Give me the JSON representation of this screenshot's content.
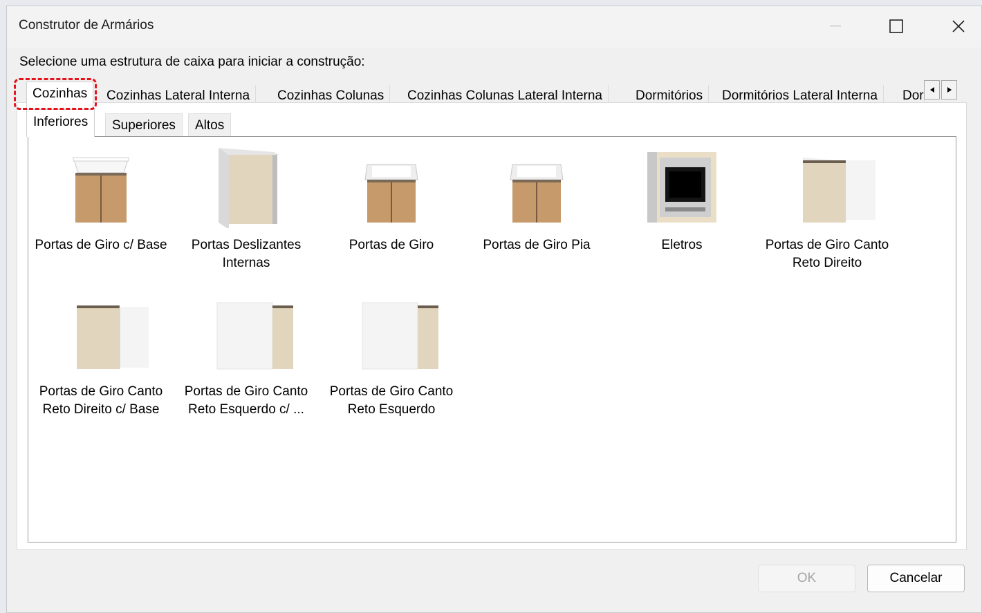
{
  "window": {
    "title": "Construtor de Armários"
  },
  "prompt": "Selecione uma estrutura de caixa para iniciar a construção:",
  "tabs": [
    {
      "label": "Cozinhas",
      "selected": true
    },
    {
      "label": "Cozinhas Lateral Interna"
    },
    {
      "label": "Cozinhas Colunas"
    },
    {
      "label": "Cozinhas Colunas Lateral Interna"
    },
    {
      "label": "Dormitórios"
    },
    {
      "label": "Dormitórios Lateral Interna"
    },
    {
      "label": "Dor"
    }
  ],
  "subtabs": [
    {
      "label": "Inferiores",
      "selected": true
    },
    {
      "label": "Superiores"
    },
    {
      "label": "Altos"
    }
  ],
  "items": [
    {
      "label": "Portas de Giro c/ Base",
      "icon": "cabinet-base-icon"
    },
    {
      "label": "Portas Deslizantes Internas",
      "icon": "sliding-cabinet-icon"
    },
    {
      "label": "Portas de Giro",
      "icon": "swing-cabinet-icon"
    },
    {
      "label": "Portas de Giro Pia",
      "icon": "sink-cabinet-icon"
    },
    {
      "label": "Eletros",
      "icon": "oven-icon"
    },
    {
      "label": "Portas de Giro Canto Reto Direito",
      "icon": "corner-right-icon"
    },
    {
      "label": "Portas de Giro Canto Reto Direito c/ Base",
      "icon": "corner-right-base-icon"
    },
    {
      "label": "Portas de Giro Canto Reto Esquerdo c/ ...",
      "icon": "corner-left-base-icon"
    },
    {
      "label": "Portas de Giro Canto Reto Esquerdo",
      "icon": "corner-left-icon"
    }
  ],
  "buttons": {
    "ok": "OK",
    "cancel": "Cancelar"
  },
  "colors": {
    "highlight": "#e5131c",
    "wood": "#c69a6a",
    "beige": "#e1d5bd"
  }
}
